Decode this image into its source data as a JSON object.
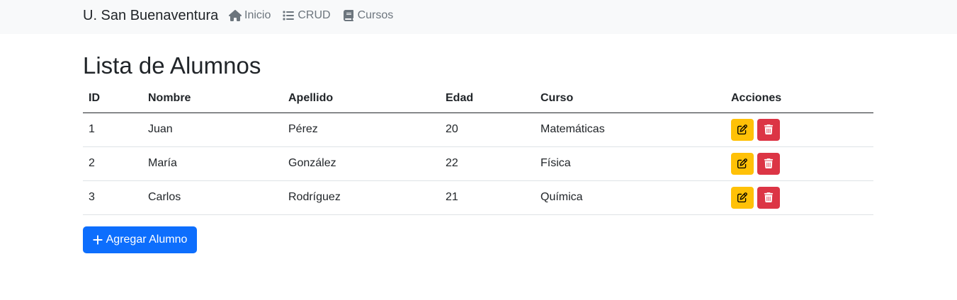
{
  "navbar": {
    "brand": "U. San Buenaventura",
    "links": [
      {
        "label": "Inicio",
        "icon": "home-icon"
      },
      {
        "label": "CRUD",
        "icon": "list-icon"
      },
      {
        "label": "Cursos",
        "icon": "book-icon"
      }
    ]
  },
  "page": {
    "title": "Lista de Alumnos"
  },
  "table": {
    "headers": [
      "ID",
      "Nombre",
      "Apellido",
      "Edad",
      "Curso",
      "Acciones"
    ],
    "rows": [
      {
        "id": "1",
        "nombre": "Juan",
        "apellido": "Pérez",
        "edad": "20",
        "curso": "Matemáticas"
      },
      {
        "id": "2",
        "nombre": "María",
        "apellido": "González",
        "edad": "22",
        "curso": "Física"
      },
      {
        "id": "3",
        "nombre": "Carlos",
        "apellido": "Rodríguez",
        "edad": "21",
        "curso": "Química"
      }
    ]
  },
  "actions": {
    "add_label": "Agregar Alumno"
  },
  "colors": {
    "navbar_bg": "#f8f9fa",
    "primary": "#0d6efd",
    "warning": "#ffc107",
    "danger": "#dc3545",
    "muted": "#6c757d"
  }
}
